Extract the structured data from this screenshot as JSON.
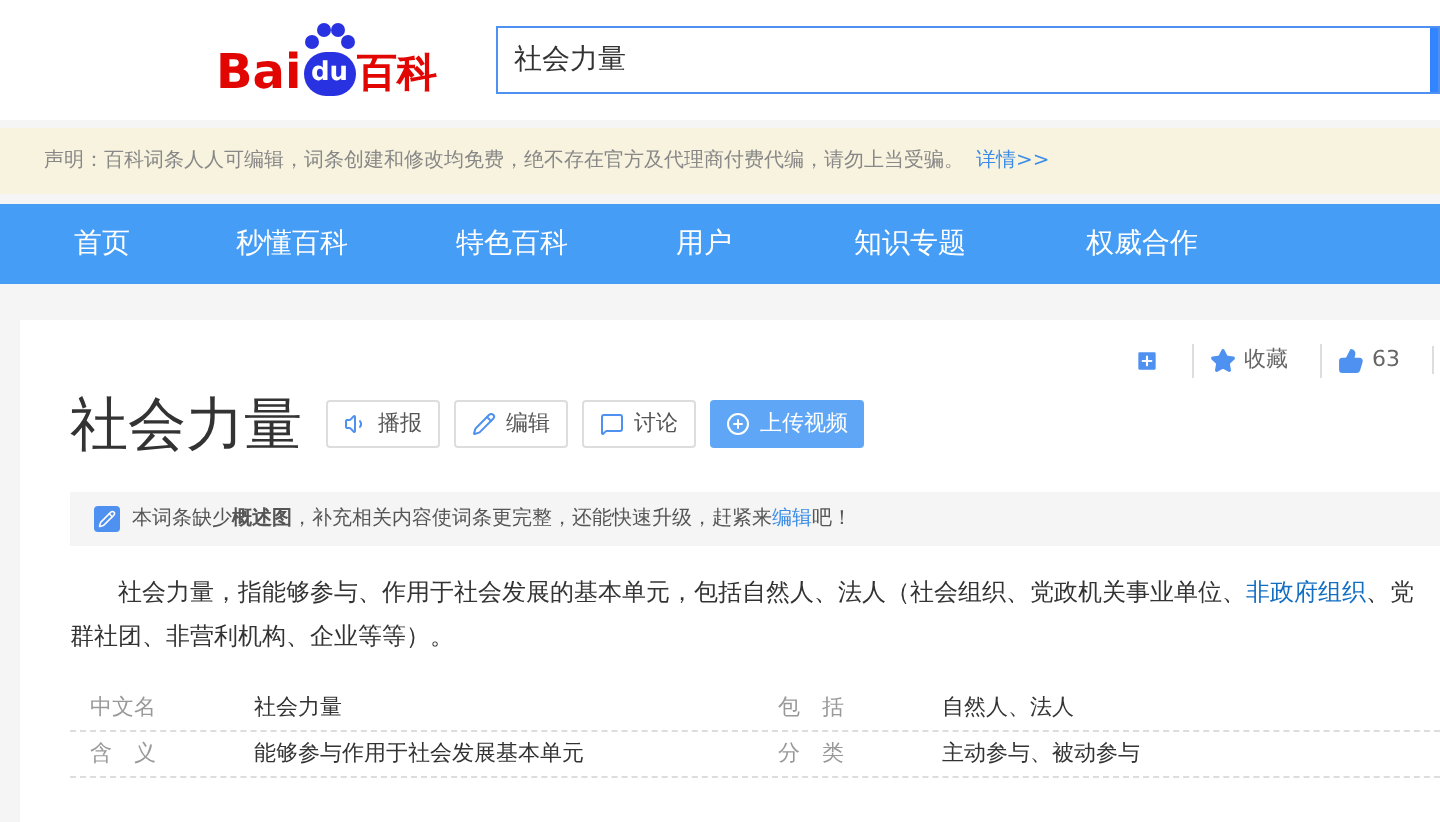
{
  "logo": {
    "part_1": "Bai",
    "part_2": "du",
    "part_3": "百科"
  },
  "search": {
    "value": "社会力量"
  },
  "notice": {
    "text": "声明：百科词条人人可编辑，词条创建和修改均免费，绝不存在官方及代理商付费代编，请勿上当受骗。",
    "link": "详情>>"
  },
  "nav": [
    "首页",
    "秒懂百科",
    "特色百科",
    "用户",
    "知识专题",
    "权威合作"
  ],
  "tools": [
    {
      "kind": "add"
    },
    {
      "kind": "star",
      "label": "收藏"
    },
    {
      "kind": "like",
      "label": "63"
    }
  ],
  "title": "社会力量",
  "actions": [
    {
      "kind": "sound",
      "label": "播报",
      "primary": false
    },
    {
      "kind": "edit",
      "label": "编辑",
      "primary": false
    },
    {
      "kind": "chat",
      "label": "讨论",
      "primary": false
    },
    {
      "kind": "upload",
      "label": "上传视频",
      "primary": true
    }
  ],
  "tip": "本词条缺少**概述图**，补充相关内容使词条更完整，还能快速升级，赶紧来",
  "tip_link": "编辑",
  "tip_end": "吧！",
  "paragraph": {
    "before": "社会力量，指能够参与、作用于社会发展的基本单元，包括自然人、法人（社会组织、党政机关事业单位、",
    "link": "非政府组织",
    "after": "、党",
    "line_2": "群社团、非营利机构、企业等等）。"
  },
  "basic_info": [
    {
      "label_1": "中文名",
      "value_1": "社会力量",
      "label_2": "包　括",
      "value_2": "自然人、法人"
    },
    {
      "label_1": "含　义",
      "value_1": "能够参与作用于社会发展基本单元",
      "label_2": "分　类",
      "value_2": "主动参与、被动参与"
    }
  ]
}
